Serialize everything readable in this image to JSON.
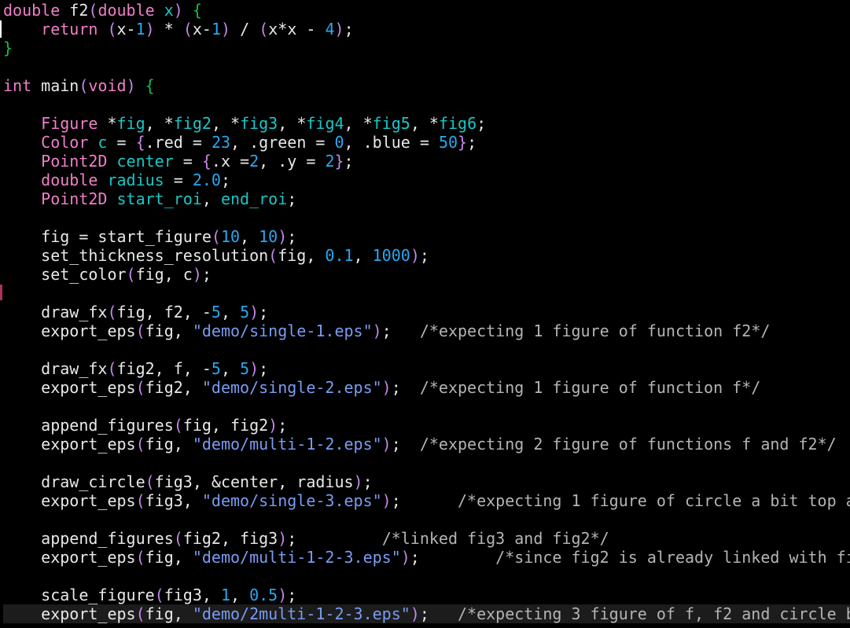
{
  "editor": {
    "colors": {
      "background": "#000000",
      "plain": "#e8e8e8",
      "keyword": "#f07fc8",
      "identifier": "#19c7c7",
      "number": "#29a8f0",
      "string": "#7a9cf2",
      "comment": "#b4b4b4",
      "brace": "#0fbf4e",
      "paren": "#c487e8"
    },
    "lines": [
      [
        [
          "pink",
          "double "
        ],
        [
          "plain",
          "f2"
        ],
        [
          "paren",
          "("
        ],
        [
          "pink",
          "double "
        ],
        [
          "cyan",
          "x"
        ],
        [
          "paren",
          ")"
        ],
        [
          "plain",
          " "
        ],
        [
          "brace",
          "{"
        ]
      ],
      [
        [
          "plain",
          "    "
        ],
        [
          "pink",
          "return "
        ],
        [
          "paren",
          "("
        ],
        [
          "plain",
          "x-"
        ],
        [
          "num",
          "1"
        ],
        [
          "paren",
          ")"
        ],
        [
          "plain",
          " * "
        ],
        [
          "paren",
          "("
        ],
        [
          "plain",
          "x-"
        ],
        [
          "num",
          "1"
        ],
        [
          "paren",
          ")"
        ],
        [
          "plain",
          " / "
        ],
        [
          "paren",
          "("
        ],
        [
          "plain",
          "x*x - "
        ],
        [
          "num",
          "4"
        ],
        [
          "paren",
          ")"
        ],
        [
          "plain",
          ";"
        ]
      ],
      [
        [
          "brace",
          "}"
        ]
      ],
      [],
      [
        [
          "pink",
          "int "
        ],
        [
          "plain",
          "main"
        ],
        [
          "paren",
          "("
        ],
        [
          "pink",
          "void"
        ],
        [
          "paren",
          ")"
        ],
        [
          "plain",
          " "
        ],
        [
          "brace",
          "{"
        ]
      ],
      [],
      [
        [
          "plain",
          "    "
        ],
        [
          "pink",
          "Figure "
        ],
        [
          "plain",
          "*"
        ],
        [
          "cyan",
          "fig"
        ],
        [
          "plain",
          ", *"
        ],
        [
          "cyan",
          "fig2"
        ],
        [
          "plain",
          ", *"
        ],
        [
          "cyan",
          "fig3"
        ],
        [
          "plain",
          ", *"
        ],
        [
          "cyan",
          "fig4"
        ],
        [
          "plain",
          ", *"
        ],
        [
          "cyan",
          "fig5"
        ],
        [
          "plain",
          ", *"
        ],
        [
          "cyan",
          "fig6"
        ],
        [
          "plain",
          ";"
        ]
      ],
      [
        [
          "plain",
          "    "
        ],
        [
          "pink",
          "Color "
        ],
        [
          "cyan",
          "c"
        ],
        [
          "plain",
          " = "
        ],
        [
          "paren",
          "{"
        ],
        [
          "plain",
          ".red = "
        ],
        [
          "num",
          "23"
        ],
        [
          "plain",
          ", .green = "
        ],
        [
          "num",
          "0"
        ],
        [
          "plain",
          ", .blue = "
        ],
        [
          "num",
          "50"
        ],
        [
          "paren",
          "}"
        ],
        [
          "plain",
          ";"
        ]
      ],
      [
        [
          "plain",
          "    "
        ],
        [
          "pink",
          "Point2D "
        ],
        [
          "cyan",
          "center"
        ],
        [
          "plain",
          " = "
        ],
        [
          "paren",
          "{"
        ],
        [
          "plain",
          ".x ="
        ],
        [
          "num",
          "2"
        ],
        [
          "plain",
          ", .y = "
        ],
        [
          "num",
          "2"
        ],
        [
          "paren",
          "}"
        ],
        [
          "plain",
          ";"
        ]
      ],
      [
        [
          "plain",
          "    "
        ],
        [
          "pink",
          "double "
        ],
        [
          "cyan",
          "radius"
        ],
        [
          "plain",
          " = "
        ],
        [
          "num",
          "2.0"
        ],
        [
          "plain",
          ";"
        ]
      ],
      [
        [
          "plain",
          "    "
        ],
        [
          "pink",
          "Point2D "
        ],
        [
          "cyan",
          "start_roi"
        ],
        [
          "plain",
          ", "
        ],
        [
          "cyan",
          "end_roi"
        ],
        [
          "plain",
          ";"
        ]
      ],
      [],
      [
        [
          "plain",
          "    fig = start_figure"
        ],
        [
          "paren",
          "("
        ],
        [
          "num",
          "10"
        ],
        [
          "plain",
          ", "
        ],
        [
          "num",
          "10"
        ],
        [
          "paren",
          ")"
        ],
        [
          "plain",
          ";"
        ]
      ],
      [
        [
          "plain",
          "    set_thickness_resolution"
        ],
        [
          "paren",
          "("
        ],
        [
          "plain",
          "fig, "
        ],
        [
          "num",
          "0.1"
        ],
        [
          "plain",
          ", "
        ],
        [
          "num",
          "1000"
        ],
        [
          "paren",
          ")"
        ],
        [
          "plain",
          ";"
        ]
      ],
      [
        [
          "plain",
          "    set_color"
        ],
        [
          "paren",
          "("
        ],
        [
          "plain",
          "fig, c"
        ],
        [
          "paren",
          ")"
        ],
        [
          "plain",
          ";"
        ]
      ],
      [],
      [
        [
          "plain",
          "    draw_fx"
        ],
        [
          "paren",
          "("
        ],
        [
          "plain",
          "fig, f2, -"
        ],
        [
          "num",
          "5"
        ],
        [
          "plain",
          ", "
        ],
        [
          "num",
          "5"
        ],
        [
          "paren",
          ")"
        ],
        [
          "plain",
          ";"
        ]
      ],
      [
        [
          "plain",
          "    export_eps"
        ],
        [
          "paren",
          "("
        ],
        [
          "plain",
          "fig, "
        ],
        [
          "str",
          "\"demo/single-1.eps\""
        ],
        [
          "paren",
          ")"
        ],
        [
          "plain",
          ";   "
        ],
        [
          "com",
          "/*expecting 1 figure of function f2*/"
        ]
      ],
      [],
      [
        [
          "plain",
          "    draw_fx"
        ],
        [
          "paren",
          "("
        ],
        [
          "plain",
          "fig2, f, -"
        ],
        [
          "num",
          "5"
        ],
        [
          "plain",
          ", "
        ],
        [
          "num",
          "5"
        ],
        [
          "paren",
          ")"
        ],
        [
          "plain",
          ";"
        ]
      ],
      [
        [
          "plain",
          "    export_eps"
        ],
        [
          "paren",
          "("
        ],
        [
          "plain",
          "fig2, "
        ],
        [
          "str",
          "\"demo/single-2.eps\""
        ],
        [
          "paren",
          ")"
        ],
        [
          "plain",
          ";  "
        ],
        [
          "com",
          "/*expecting 1 figure of function f*/"
        ]
      ],
      [],
      [
        [
          "plain",
          "    append_figures"
        ],
        [
          "paren",
          "("
        ],
        [
          "plain",
          "fig, fig2"
        ],
        [
          "paren",
          ")"
        ],
        [
          "plain",
          ";"
        ]
      ],
      [
        [
          "plain",
          "    export_eps"
        ],
        [
          "paren",
          "("
        ],
        [
          "plain",
          "fig, "
        ],
        [
          "str",
          "\"demo/multi-1-2.eps\""
        ],
        [
          "paren",
          ")"
        ],
        [
          "plain",
          ";  "
        ],
        [
          "com",
          "/*expecting 2 figure of functions f and f2*/"
        ]
      ],
      [],
      [
        [
          "plain",
          "    draw_circle"
        ],
        [
          "paren",
          "("
        ],
        [
          "plain",
          "fig3, &center, radius"
        ],
        [
          "paren",
          ")"
        ],
        [
          "plain",
          ";"
        ]
      ],
      [
        [
          "plain",
          "    export_eps"
        ],
        [
          "paren",
          "("
        ],
        [
          "plain",
          "fig3, "
        ],
        [
          "str",
          "\"demo/single-3.eps\""
        ],
        [
          "paren",
          ")"
        ],
        [
          "plain",
          ";      "
        ],
        [
          "com",
          "/*expecting 1 figure of circle a bit top a"
        ]
      ],
      [],
      [
        [
          "plain",
          "    append_figures"
        ],
        [
          "paren",
          "("
        ],
        [
          "plain",
          "fig2, fig3"
        ],
        [
          "paren",
          ")"
        ],
        [
          "plain",
          ";         "
        ],
        [
          "com",
          "/*linked fig3 and fig2*/"
        ]
      ],
      [
        [
          "plain",
          "    export_eps"
        ],
        [
          "paren",
          "("
        ],
        [
          "plain",
          "fig, "
        ],
        [
          "str",
          "\"demo/multi-1-2-3.eps\""
        ],
        [
          "paren",
          ")"
        ],
        [
          "plain",
          ";        "
        ],
        [
          "com",
          "/*since fig2 is already linked with fi"
        ]
      ],
      [],
      [
        [
          "plain",
          "    scale_figure"
        ],
        [
          "paren",
          "("
        ],
        [
          "plain",
          "fig3, "
        ],
        [
          "num",
          "1"
        ],
        [
          "plain",
          ", "
        ],
        [
          "num",
          "0.5"
        ],
        [
          "paren",
          ")"
        ],
        [
          "plain",
          ";"
        ]
      ],
      [
        [
          "plain",
          "    export_eps"
        ],
        [
          "paren",
          "("
        ],
        [
          "plain",
          "fig, "
        ],
        [
          "str",
          "\"demo/2multi-1-2-3.eps\""
        ],
        [
          "paren",
          ")"
        ],
        [
          "plain",
          ";   "
        ],
        [
          "com",
          "/*expecting 3 figure of f, f2 and circle b"
        ]
      ]
    ]
  }
}
